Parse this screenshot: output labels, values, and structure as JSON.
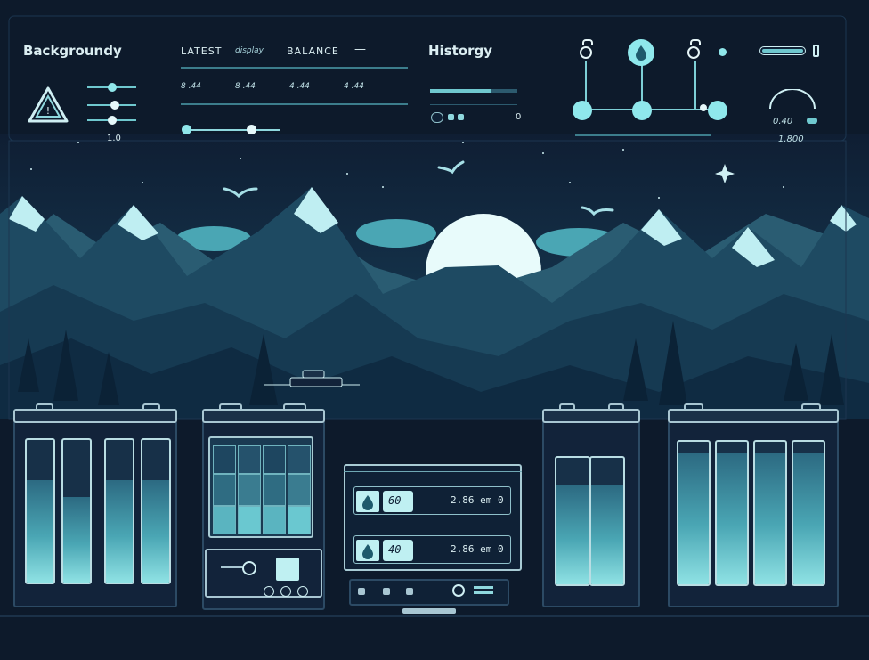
{
  "app": {
    "title": "Backgroundy",
    "tabs": [
      "LATEST",
      "display",
      "BALANCE",
      "—"
    ],
    "history_title": "Historgy"
  },
  "left_panel": {
    "warning_icon": "warning-triangle-icon",
    "value": "1.0",
    "stat_values": [
      "8 .44",
      "8 .44",
      "4 .44",
      "4 .44"
    ]
  },
  "history_panel": {
    "progress": 0.7,
    "toggle_label": "ℂ",
    "count": "0"
  },
  "top_right": {
    "readout_top": "0.40",
    "readout_bottom": "1.800",
    "battery_label": "battery-indicator-icon"
  },
  "nodes": {
    "icons": [
      "ring-icon",
      "droplet-icon",
      "ring-icon",
      "dot-icon"
    ]
  },
  "control_unit": {
    "row1": {
      "tag": "60",
      "value": "2.86 em 0"
    },
    "row2": {
      "tag": "40",
      "value": "2.86 em 0"
    }
  },
  "colors": {
    "background": "#0d1a2b",
    "accent": "#8fe6ea",
    "panel": "#12233a"
  }
}
